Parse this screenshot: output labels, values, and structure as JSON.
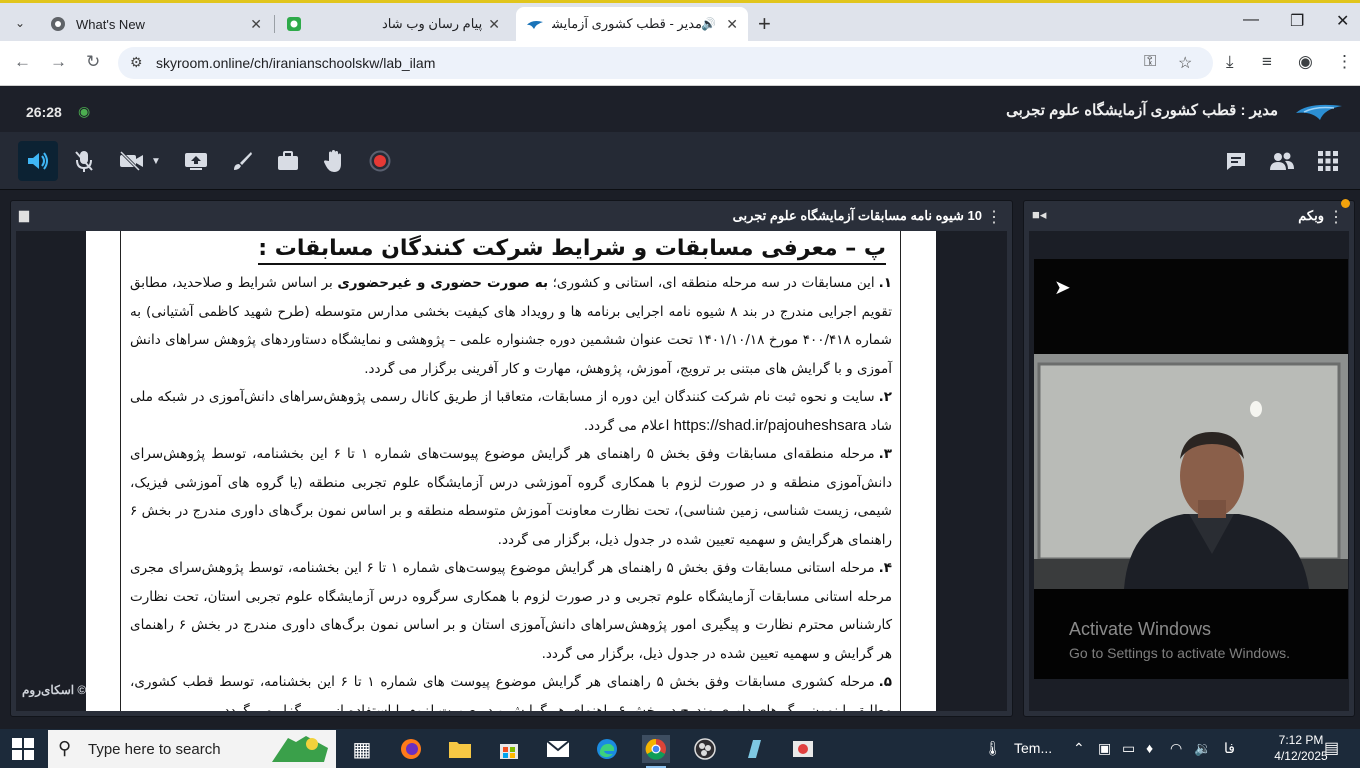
{
  "browser": {
    "tabs": [
      {
        "title": "What's New",
        "icon": "chrome-icon"
      },
      {
        "title": "پیام رسان وب شاد",
        "icon": "shad-icon"
      },
      {
        "title": "مدیر - قطب کشوری آزمایشگا",
        "icon": "skyroom-icon"
      }
    ],
    "url": "skyroom.online/ch/iranianschoolskw/lab_ilam"
  },
  "app": {
    "timer": "26:28",
    "room_title": "مدیر : قطب کشوری آزمایشگاه علوم تجربی",
    "brand": "© اسکای‌روم",
    "colors": {
      "accent": "#3fb6f5",
      "record": "#e53935",
      "panel": "#2a2f3a"
    }
  },
  "document_panel": {
    "title": "10 شیوه نامه مسابقات آزمایشگاه علوم تجربی",
    "heading": "پ – معرفی مسابقات و شرایط شرکت کنندگان مسابقات :",
    "items": [
      {
        "num": "۱.",
        "pre": "این مسابقات در سه مرحله منطقه ای، استانی و کشوری؛ ",
        "bold": "به صورت حضوری و غیرحضوری",
        "post": " بر اساس شرایط و صلاحدید، مطابق تقویم اجرایی مندرج در بند ۸ شیوه نامه اجرایی برنامه ها و رویداد های کیفیت بخشی مدارس متوسطه (طرح شهید کاظمی آشتیانی) به شماره ۴۰۰/۴۱۸ مورخ ۱۴۰۱/۱۰/۱۸ تحت عنوان ششمین دوره جشنواره علمی – پژوهشی و نمایشگاه دستاوردهای پژوهش سراهای دانش آموزی و با گرایش های مبتنی بر ترویج، آموزش، پژوهش، مهارت و کار آفرینی برگزار می گردد."
      },
      {
        "num": "۲.",
        "pre": "سایت و نحوه ثبت نام شرکت کنندگان این دوره از مسابقات، متعاقبا از طریق کانال رسمی پژوهش‌سراهای دانش‌آموزی در شبکه ملی شاد ",
        "bold": "https://shad.ir/pajouheshsara",
        "post": " اعلام می گردد."
      },
      {
        "num": "۳.",
        "pre": "مرحله منطقه‌ای مسابقات وفق بخش ۵ راهنمای هر گرایش موضوع پیوست‌های شماره ۱ تا ۶ این بخشنامه، توسط پژوهش‌سرای دانش‌آموزی منطقه و در صورت لزوم با همکاری گروه آموزشی درس آزمایشگاه علوم تجربی منطقه (یا گروه های آموزشی فیزیک، شیمی، زیست شناسی، زمین شناسی)، تحت نظارت معاونت آموزش متوسطه منطقه و بر اساس نمون برگ‌های داوری مندرج در بخش ۶ راهنمای هرگرایش و سهمیه تعیین شده در جدول ذیل، برگزار می گردد.",
        "bold": "",
        "post": ""
      },
      {
        "num": "۴.",
        "pre": "مرحله استانی مسابقات وفق بخش ۵ راهنمای هر گرایش موضوع پیوست‌های شماره ۱ تا ۶ این بخشنامه، توسط پژوهش‌سرای مجری مرحله استانی مسابقات آزمایشگاه علوم تجربی و در صورت لزوم با همکاری سرگروه درس آزمایشگاه علوم تجربی استان، تحت نظارت کارشناس محترم نظارت و پیگیری امور پژوهش‌سراهای دانش‌آموزی استان و بر اساس نمون برگ‌های داوری مندرج در بخش ۶ راهنمای هر گرایش و سهمیه تعیین شده در جدول ذیل، برگزار می گردد.",
        "bold": "",
        "post": ""
      },
      {
        "num": "۵.",
        "pre": "مرحله کشوری مسابقات وفق بخش ۵ راهنمای هر گرایش موضوع پیوست های شماره ۱ تا ۶ این بخشنامه، توسط قطب کشوری، مطابق با نمون برگ های داوری مندرج در بخش ۶ راهنمای هر گرایش و در صورت لزوم با استفاده از ... برگزار می گردد.",
        "bold": "",
        "post": ""
      }
    ]
  },
  "webcam_panel": {
    "title": "وبکم",
    "activate_title": "Activate Windows",
    "activate_sub": "Go to Settings to activate Windows."
  },
  "taskbar": {
    "search_placeholder": "Type here to search",
    "weather": "Tem...",
    "lang": "فا",
    "time": "7:12 PM",
    "date": "4/12/2025"
  }
}
